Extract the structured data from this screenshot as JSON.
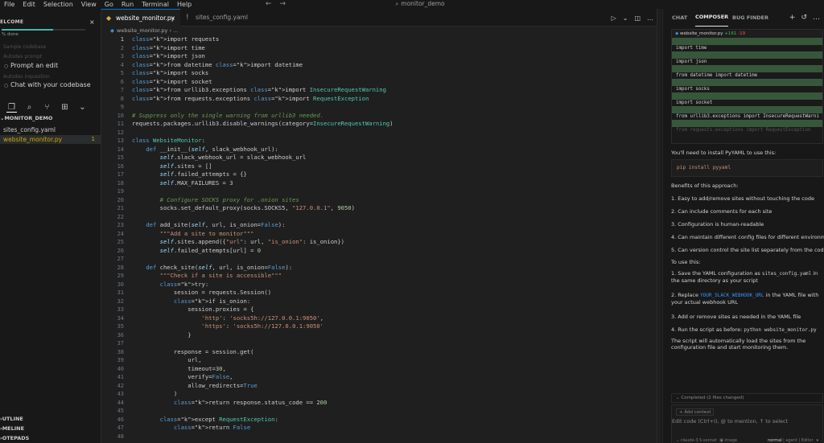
{
  "menubar": {
    "items": [
      "File",
      "Edit",
      "Selection",
      "View",
      "Go",
      "Run",
      "Terminal",
      "Help"
    ],
    "search": "monitor_demo"
  },
  "welcome": {
    "title": "ELCOME",
    "done": "% done",
    "progress_fraction": 0.62,
    "faded_items": [
      "Sample codebase",
      "Autodes prompt",
      "Autodes inquestion"
    ],
    "items": [
      "Prompt an edit",
      "Chat with your codebase"
    ]
  },
  "explorer": {
    "root": "MONITOR_DEMO",
    "files": [
      {
        "name": "sites_config.yaml",
        "badge": ""
      },
      {
        "name": "website_monitor.py",
        "badge": "1"
      }
    ],
    "sections": [
      "UTLINE",
      "MELINE",
      "OTEPADS"
    ]
  },
  "tabs": [
    {
      "label": "website_monitor.py"
    },
    {
      "label": "sites_config.yaml"
    }
  ],
  "breadcrumb": {
    "file": "website_monitor.py",
    "more": "..."
  },
  "code": {
    "line_numbers": [
      "1",
      "2",
      "3",
      "4",
      "5",
      "6",
      "7",
      "8",
      "9",
      "10",
      "11",
      "12",
      "13",
      "14",
      "15",
      "16",
      "17",
      "18",
      "19",
      "20",
      "21",
      "22",
      "23",
      "24",
      "25",
      "26",
      "27",
      "28",
      "29",
      "30",
      "31",
      "32",
      "33",
      "34",
      "35",
      "36",
      "37",
      "38",
      "39",
      "40",
      "41",
      "42",
      "43",
      "44",
      "45",
      "46",
      "47",
      "48"
    ],
    "lines": [
      "import requests",
      "import time",
      "import json",
      "from datetime import datetime",
      "import socks",
      "import socket",
      "from urllib3.exceptions import InsecureRequestWarning",
      "from requests.exceptions import RequestException",
      "",
      "# Suppress only the single warning from urllib3 needed.",
      "requests.packages.urllib3.disable_warnings(category=InsecureRequestWarning)",
      "",
      "class WebsiteMonitor:",
      "    def __init__(self, slack_webhook_url):",
      "        self.slack_webhook_url = slack_webhook_url",
      "        self.sites = []",
      "        self.failed_attempts = {}",
      "        self.MAX_FAILURES = 3",
      "",
      "        # Configure SOCKS proxy for .onion sites",
      "        socks.set_default_proxy(socks.SOCKS5, \"127.0.0.1\", 9050)",
      "",
      "    def add_site(self, url, is_onion=False):",
      "        \"\"\"Add a site to monitor\"\"\"",
      "        self.sites.append({\"url\": url, \"is_onion\": is_onion})",
      "        self.failed_attempts[url] = 0",
      "",
      "    def check_site(self, url, is_onion=False):",
      "        \"\"\"Check if a site is accessible\"\"\"",
      "        try:",
      "            session = requests.Session()",
      "            if is_onion:",
      "                session.proxies = {",
      "                    'http': 'socks5h://127.0.0.1:9050',",
      "                    'https': 'socks5h://127.0.0.1:9050'",
      "                }",
      "",
      "            response = session.get(",
      "                url,",
      "                timeout=30,",
      "                verify=False,",
      "                allow_redirects=True",
      "            )",
      "            return response.status_code == 200",
      "",
      "        except RequestException:",
      "            return False",
      ""
    ]
  },
  "panel": {
    "tabs": [
      "CHAT",
      "COMPOSER",
      "BUG FINDER"
    ],
    "diff": {
      "file": "website_monitor.py",
      "added": "+161",
      "removed": "-19",
      "lines": [
        {
          "text": "",
          "green": true
        },
        {
          "text": "import time",
          "green": false
        },
        {
          "text": "",
          "green": true
        },
        {
          "text": "import json",
          "green": false
        },
        {
          "text": "",
          "green": true
        },
        {
          "text": "from datetime import datetime",
          "green": false
        },
        {
          "text": "",
          "green": true
        },
        {
          "text": "import socks",
          "green": false
        },
        {
          "text": "",
          "green": true
        },
        {
          "text": "import socket",
          "green": false
        },
        {
          "text": "",
          "green": true
        },
        {
          "text": "from urllib3.exceptions import InsecureRequestWarni",
          "green": false
        },
        {
          "text": "",
          "green": true
        },
        {
          "text": "from requests.exceptions import RequestException",
          "green": false,
          "fade": true
        }
      ]
    },
    "install_msg": "You'll need to install PyYAML to use this:",
    "install_cmd": "pip install pyyaml",
    "benefits_title": "Benefits of this approach:",
    "benefits": [
      "1. Easy to add/remove sites without touching the code",
      "2. Can include comments for each site",
      "3. Configuration is human-readable",
      "4. Can maintain different config files for different environmen",
      "5. Can version control the site list separately from the code"
    ],
    "to_use": "To use this:",
    "steps": {
      "s1_a": "1. Save the YAML configuration as",
      "s1_code": "sites_config.yaml",
      "s1_b": "in",
      "s1_c": "the same directory as your script",
      "s2_a": "2. Replace",
      "s2_code": "YOUR_SLACK_WEBHOOK_URL",
      "s2_b": "in the YAML file with",
      "s2_c": "your actual webhook URL",
      "s3": "3. Add or remove sites as needed in the YAML file",
      "s4_a": "4. Run the script as before:",
      "s4_code": "python website_monitor.py"
    },
    "closing_1": "The script will automatically load the sites from the",
    "closing_2": "configuration file and start monitoring them.",
    "completed": "Completed (2 files changed)",
    "add_context": "+ Add context",
    "input_placeholder": "Edit code (Ctrl+I), @ to mention, ↑ to select",
    "model": "claude-3.5-sonnet",
    "image": "image",
    "mode": "normal",
    "agent": "agent",
    "editor_mode": "Editor"
  }
}
